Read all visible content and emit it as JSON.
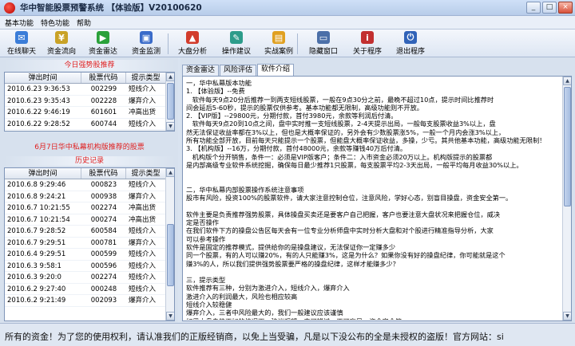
{
  "window": {
    "title": "华中智能股票预警系统 【体验版】V20100620",
    "buttons": {
      "minimize": "_",
      "maximize": "□",
      "close": "×"
    }
  },
  "menu": [
    "基本功能",
    "特色功能",
    "帮助"
  ],
  "toolbar": [
    {
      "label": "在线聊天",
      "icon": "chat-icon",
      "color": "#3b7dd8",
      "glyph": "✉"
    },
    {
      "label": "资金流向",
      "icon": "money-flow-icon",
      "color": "#c9a227",
      "glyph": "¥"
    },
    {
      "label": "资金雷达",
      "icon": "radar-icon",
      "color": "#2aa13a",
      "glyph": "▶"
    },
    {
      "label": "资金监测",
      "icon": "monitor-icon",
      "color": "#3a6bc9",
      "glyph": "▣"
    },
    {
      "label": "大盘分析",
      "icon": "market-analysis-icon",
      "color": "#d23c2c",
      "glyph": "▲"
    },
    {
      "label": "操作建议",
      "icon": "advice-icon",
      "color": "#2d9c8a",
      "glyph": "✎"
    },
    {
      "label": "实战案例",
      "icon": "case-icon",
      "color": "#e0a020",
      "glyph": "▤"
    },
    {
      "label": "隐藏窗口",
      "icon": "hide-window-icon",
      "color": "#4b6fa8",
      "glyph": "▭"
    },
    {
      "label": "关于程序",
      "icon": "about-icon",
      "color": "#c23030",
      "glyph": "i"
    },
    {
      "label": "退出程序",
      "icon": "exit-icon",
      "color": "#3163b8",
      "glyph": "⏻"
    }
  ],
  "left": {
    "top_title": "今日强势股推荐",
    "columns": [
      "弹出时间",
      "股票代码",
      "提示类型"
    ],
    "top_rows": [
      [
        "2010.6.23 9:36:53",
        "002299",
        "短线介入"
      ],
      [
        "2010.6.23 9:35:43",
        "002228",
        "爆弃介入"
      ],
      [
        "2010.6.22 9:46:19",
        "601601",
        "冲高出货"
      ],
      [
        "2010.6.22 9:28:52",
        "600744",
        "短线介入"
      ]
    ],
    "mid_title": "6月7日华中私幕机构版推荐的股票",
    "history_title": "历史记录",
    "history_rows": [
      [
        "2010.6.8 9:29:46",
        "000823",
        "短线介入"
      ],
      [
        "2010.6.8 9:24:21",
        "000938",
        "爆弃介入"
      ],
      [
        "2010.6.7 10:21:55",
        "002274",
        "冲高出货"
      ],
      [
        "2010.6.7 10:21:54",
        "000274",
        "冲高出货"
      ],
      [
        "2010.6.7 9:28:52",
        "600584",
        "短线介入"
      ],
      [
        "2010.6.7 9:29:51",
        "000781",
        "爆弃介入"
      ],
      [
        "2010.6.4 9:29:51",
        "000599",
        "短线介入"
      ],
      [
        "2010.6.3 9:58:1",
        "000596",
        "短线介入"
      ],
      [
        "2010.6.3 9:20:0",
        "002274",
        "短线介入"
      ],
      [
        "2010.6.2 9:27:40",
        "000248",
        "短线介入"
      ],
      [
        "2010.6.2 9:21:49",
        "002093",
        "爆弃介入"
      ]
    ]
  },
  "right": {
    "tabs": [
      "资金雷达",
      "风险评估",
      "软件介绍"
    ],
    "active_tab": 2,
    "content": "一，华中私幕版本功能\n1. 【体验版】--免费\n   软件每天9点20分后推荐一到两支短线股票，一般在9点30分之前，最晚不超过10点，提示时间比推荐时\n间会延后5-60秒，提示的股票仅供参考。基本功能都无限制，高级功能则不开放。\n2. 【VIP版】--29800元，分期付款，首付3980元，余款等利润后付清。\n   软件每天9点20到10点之间，盘中实时推一支短线股票，2-4天提示出局，一般每支股票收益3%以上，盘\n然无法保证收益率都在3%以上，但也是大概率保证的，另外会有少数股票涨5%，一般一个月内会涨3%以上，\n所有功能全部开放，目前每天只能提示一个股票，但能盘大概率保证收益，多操，少亏。其共他基本功能，高级功能无限制！\n3. 【机构版】--16万，分期付款，首付48000元，余款等赚钱40万后付清。\n   机构版个分开销售，条件一：必须是VIP版客户；条件二：入市资金必须20万以上。机构版提示的股票都\n是内部高级专业软件系统挖掘，确保每日最少推荐1只股票，每支股票平均2-3天出局，一般平均每月收益30%以上。\n\n\n二，华中私幕内部股票操作系统注意事项\n股市有风险，投资100%的股票软件，请大家注意控制仓位，注意风险，学好心态，别盲目操盘，资金安全第一。\n\n软件主要是负责推荐强势股票，具体操盘买卖还是要客户自己把握，客户也要注意大盘状况来把握仓位，威决\n定是否操作\n在我们软件下方的操盘公告区每天会有一位专业分析师盘中实时分析大盘和对个股进行精准指导分析，大家\n可以参考操作\n软件是固定的推荐模式，提供给你的是操盘建议，无法保证你一定赚多少\n同一个股票，有的人可以赚20%，有的人只能赚3%，这是为什么？如果你没有好的操盘纪律，你可能就是这个\n赚3%的人，所以我们提供强势股票要严格的操盘纪律，这样才能赚多少？\n\n三，提示类型\n软件推荐有三种，分别为激进介入，短线介入，爆弃介入\n激进介入的利润最大，风险也相应较高\n短线介入较稳健\n爆弃介入，三者中风险最大的，我们一般建议应该谨慎\n如果大盘走势不好的情况下，建议观望，宁可错过，不可盲目，资金安全第一。\n短线持股一到五天，一般在三天内，很多可以实现第二天获利出货"
  },
  "status": {
    "marquee": "所有的资金！为了您的使用权利，请认准我们的正版经销商，以免上当受骗，凡是以下没公布的全是未授权的盗版！官方网站：si"
  }
}
